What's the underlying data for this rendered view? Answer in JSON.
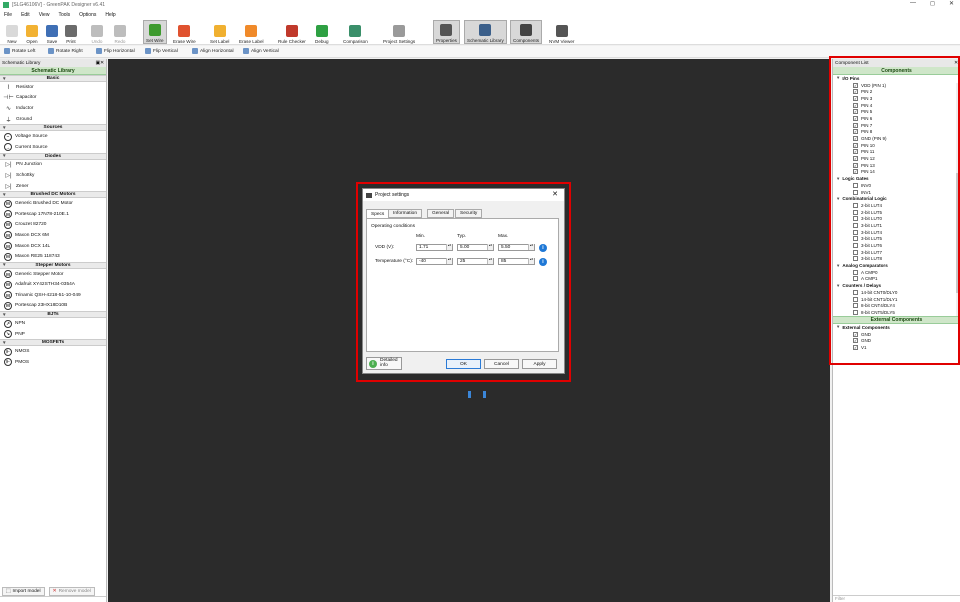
{
  "titlebar": {
    "title": "[SLG46106V] - GreenPAK Designer v6.41",
    "minimize": "—",
    "maximize": "◻",
    "close": "✕"
  },
  "menu": [
    "File",
    "Edit",
    "View",
    "Tools",
    "Options",
    "Help"
  ],
  "toolbar": [
    {
      "label": "New",
      "color": "#d9d9d9",
      "state": "normal"
    },
    {
      "label": "Open",
      "color": "#f2b233",
      "state": "normal"
    },
    {
      "label": "Save",
      "color": "#3f6fb5",
      "state": "normal"
    },
    {
      "label": "Print",
      "color": "#6b6b6b",
      "state": "normal"
    },
    {
      "label": "Undo",
      "color": "#bdbdbd",
      "state": "dim"
    },
    {
      "label": "Redo",
      "color": "#bdbdbd",
      "state": "dim"
    },
    {
      "label": "Set Wire",
      "color": "#3e9a2e",
      "state": "active"
    },
    {
      "label": "Erase Wire",
      "color": "#e0522f",
      "state": "normal"
    },
    {
      "label": "Set Label",
      "color": "#f0b030",
      "state": "normal"
    },
    {
      "label": "Erase Label",
      "color": "#f08a2a",
      "state": "normal"
    },
    {
      "label": "Rule Checker",
      "color": "#c0392b",
      "state": "normal"
    },
    {
      "label": "Debug",
      "color": "#2ea043",
      "state": "normal"
    },
    {
      "label": "Comparison",
      "color": "#3a8f6a",
      "state": "normal"
    },
    {
      "label": "Project Settings",
      "color": "#9a9a9a",
      "state": "normal"
    },
    {
      "label": "Properties",
      "color": "#555555",
      "state": "active"
    },
    {
      "label": "Schematic Library",
      "color": "#3b5f8a",
      "state": "active"
    },
    {
      "label": "Components",
      "color": "#444444",
      "state": "active"
    },
    {
      "label": "NVM Viewer",
      "color": "#555555",
      "state": "normal"
    }
  ],
  "toolbar2": [
    "Rotate Left",
    "Rotate Right",
    "Flip Horizontal",
    "Flip Vertical",
    "Align Horizontal",
    "Align Vertical"
  ],
  "library": {
    "panel_title": "Schematic Library",
    "header": "Schematic Library",
    "sections": [
      {
        "title": "Basic",
        "items": [
          {
            "label": "Resistor",
            "icon": "resistor-icon"
          },
          {
            "label": "Capacitor",
            "icon": "capacitor-icon"
          },
          {
            "label": "Inductor",
            "icon": "inductor-icon"
          },
          {
            "label": "Ground",
            "icon": "ground-icon"
          }
        ]
      },
      {
        "title": "Sources",
        "items": [
          {
            "label": "Voltage Source",
            "icon": "voltage-source-icon"
          },
          {
            "label": "Current Source",
            "icon": "current-source-icon"
          }
        ]
      },
      {
        "title": "Diodes",
        "items": [
          {
            "label": "PN Junction",
            "icon": "diode-icon"
          },
          {
            "label": "Schottky",
            "icon": "schottky-icon"
          },
          {
            "label": "Zener",
            "icon": "zener-icon"
          }
        ]
      },
      {
        "title": "Brushed DC Motors",
        "items": [
          {
            "label": "Generic Brushed DC Motor",
            "icon": "motor-icon"
          },
          {
            "label": "Portescap 17N78-210E.1",
            "icon": "motor-icon"
          },
          {
            "label": "Crouzet 82720",
            "icon": "motor-icon"
          },
          {
            "label": "Maxon DCX 6M",
            "icon": "motor-icon"
          },
          {
            "label": "Maxon DCX 14L",
            "icon": "motor-icon"
          },
          {
            "label": "Maxon RE25 118743",
            "icon": "motor-icon"
          }
        ]
      },
      {
        "title": "Stepper Motors",
        "items": [
          {
            "label": "Generic Stepper Motor",
            "icon": "motor-icon"
          },
          {
            "label": "Adafruit XY42STH34-0354A",
            "icon": "motor-icon"
          },
          {
            "label": "Trinamic QSH-4218-51-10-049",
            "icon": "motor-icon"
          },
          {
            "label": "Portescap 23HX18D10B",
            "icon": "motor-icon"
          }
        ]
      },
      {
        "title": "BJTs",
        "items": [
          {
            "label": "NPN",
            "icon": "npn-icon"
          },
          {
            "label": "PNP",
            "icon": "pnp-icon"
          }
        ]
      },
      {
        "title": "MOSFETs",
        "items": [
          {
            "label": "NMOS",
            "icon": "nmos-icon"
          },
          {
            "label": "PMOS",
            "icon": "pmos-icon"
          }
        ]
      }
    ],
    "import_button": "Import model",
    "remove_button": "Remove model"
  },
  "dialog": {
    "title": "Project settings",
    "tabs": [
      "Specs",
      "Information",
      "General",
      "Security"
    ],
    "selected_tab": "Specs",
    "group_label": "Operating conditions",
    "col_headers": [
      "Min.",
      "Typ.",
      "Max."
    ],
    "rows": [
      {
        "label": "VDD (V):",
        "min": "1.71",
        "typ": "5.00",
        "max": "5.50"
      },
      {
        "label": "Temperature (°C):",
        "min": "-40",
        "typ": "25",
        "max": "85"
      }
    ],
    "detailed_info": "Detailed info",
    "ok": "OK",
    "cancel": "Cancel",
    "apply": "Apply"
  },
  "components": {
    "panel_title": "Component List",
    "header": "Components",
    "groups": [
      {
        "title": "I/O Pins",
        "items": [
          {
            "label": "VDD (PIN 1)",
            "checked": true
          },
          {
            "label": "PIN 2",
            "checked": true
          },
          {
            "label": "PIN 3",
            "checked": true
          },
          {
            "label": "PIN 4",
            "checked": true
          },
          {
            "label": "PIN 5",
            "checked": true
          },
          {
            "label": "PIN 6",
            "checked": true
          },
          {
            "label": "PIN 7",
            "checked": true
          },
          {
            "label": "PIN 8",
            "checked": true
          },
          {
            "label": "GND (PIN 9)",
            "checked": true
          },
          {
            "label": "PIN 10",
            "checked": true
          },
          {
            "label": "PIN 11",
            "checked": true
          },
          {
            "label": "PIN 12",
            "checked": true
          },
          {
            "label": "PIN 13",
            "checked": true
          },
          {
            "label": "PIN 14",
            "checked": true
          }
        ]
      },
      {
        "title": "Logic Gates",
        "items": [
          {
            "label": "INV0",
            "checked": false
          },
          {
            "label": "INV1",
            "checked": false
          }
        ]
      },
      {
        "title": "Combinatorial Logic",
        "items": [
          {
            "label": "2-bit LUT4",
            "checked": false
          },
          {
            "label": "2-bit LUT5",
            "checked": false
          },
          {
            "label": "3-bit LUT0",
            "checked": false
          },
          {
            "label": "3-bit LUT1",
            "checked": false
          },
          {
            "label": "3-bit LUT4",
            "checked": false
          },
          {
            "label": "3-bit LUT5",
            "checked": false
          },
          {
            "label": "3-bit LUT6",
            "checked": false
          },
          {
            "label": "3-bit LUT7",
            "checked": false
          },
          {
            "label": "3-bit LUT8",
            "checked": false
          }
        ]
      },
      {
        "title": "Analog Comparators",
        "items": [
          {
            "label": "A CMP0",
            "checked": false
          },
          {
            "label": "A CMP1",
            "checked": false
          }
        ]
      },
      {
        "title": "Counters / Delays",
        "items": [
          {
            "label": "14-bit CNT0/DLY0",
            "checked": false
          },
          {
            "label": "14-bit CNT1/DLY1",
            "checked": false
          },
          {
            "label": "8-bit CNT4/DLY4",
            "checked": false
          },
          {
            "label": "8-bit CNT5/DLY5",
            "checked": false
          },
          {
            "label": "8-bit CNT6/DLY6",
            "checked": false
          }
        ]
      }
    ],
    "external_header": "External Components",
    "external_group": "External Components",
    "external_items": [
      {
        "label": "GND",
        "checked": true
      },
      {
        "label": "GND",
        "checked": true
      },
      {
        "label": "V1",
        "checked": true
      }
    ],
    "filter_placeholder": "Filter"
  },
  "colors": {
    "highlight": "#e00000",
    "canvas": "#2b2b2b",
    "library_green": "#cfe6c9",
    "info_blue": "#1e78d6"
  }
}
